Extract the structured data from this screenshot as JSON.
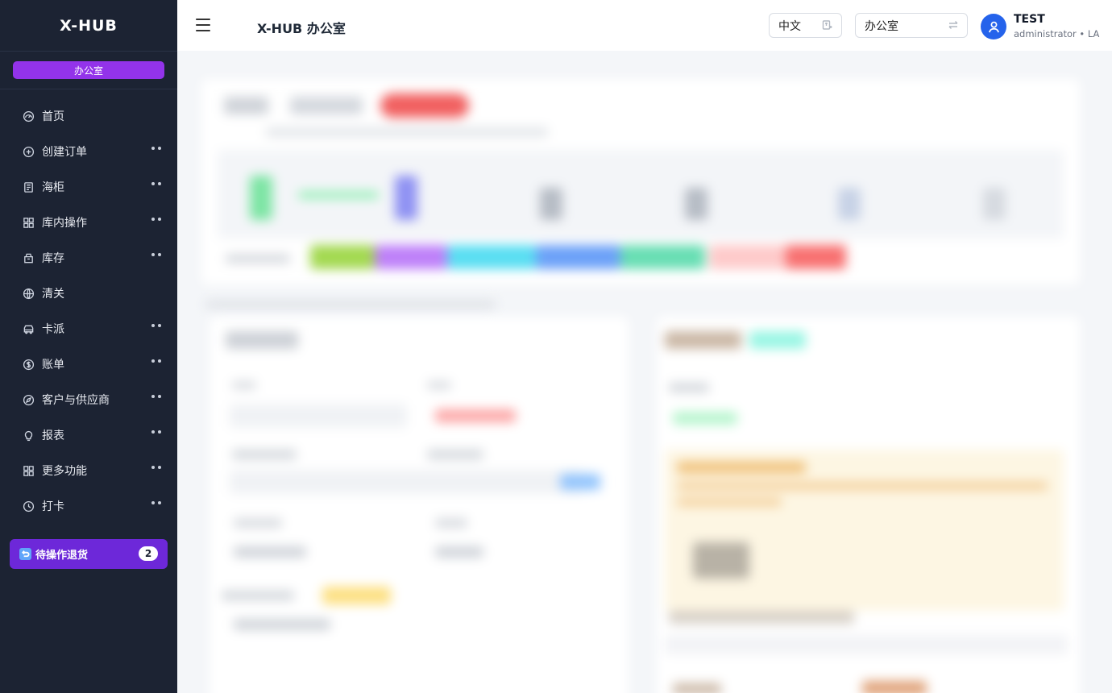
{
  "sidebar": {
    "brand": "X-HUB",
    "office_badge": "办公室",
    "items": [
      {
        "label": "首页",
        "icon": "dashboard-icon",
        "has_submenu": false
      },
      {
        "label": "创建订单",
        "icon": "plus-circle-icon",
        "has_submenu": true
      },
      {
        "label": "海柜",
        "icon": "container-icon",
        "has_submenu": true
      },
      {
        "label": "库内操作",
        "icon": "grid-icon",
        "has_submenu": true
      },
      {
        "label": "库存",
        "icon": "inventory-box-icon",
        "has_submenu": true
      },
      {
        "label": "清关",
        "icon": "globe-icon",
        "has_submenu": false
      },
      {
        "label": "卡派",
        "icon": "truck-icon",
        "has_submenu": true
      },
      {
        "label": "账单",
        "icon": "dollar-circle-icon",
        "has_submenu": true
      },
      {
        "label": "客户与供应商",
        "icon": "compass-icon",
        "has_submenu": true
      },
      {
        "label": "报表",
        "icon": "lightbulb-icon",
        "has_submenu": true
      },
      {
        "label": "更多功能",
        "icon": "apps-grid-icon",
        "has_submenu": true
      },
      {
        "label": "打卡",
        "icon": "clock-icon",
        "has_submenu": true
      }
    ],
    "pending": {
      "label": "待操作退货",
      "count": "2",
      "icon": "return-icon"
    }
  },
  "header": {
    "title": "X-HUB 办公室",
    "language": {
      "value": "中文",
      "icon": "translate-icon"
    },
    "office": {
      "value": "办公室",
      "icon": "swap-icon"
    },
    "user": {
      "name": "TEST",
      "role": "administrator • LA",
      "icon": "user-icon"
    }
  },
  "colors": {
    "sidebar_bg": "#1c2333",
    "office_badge": "#9333ea",
    "pending_bg": "#6d28d9",
    "avatar_bg": "#2563eb"
  }
}
